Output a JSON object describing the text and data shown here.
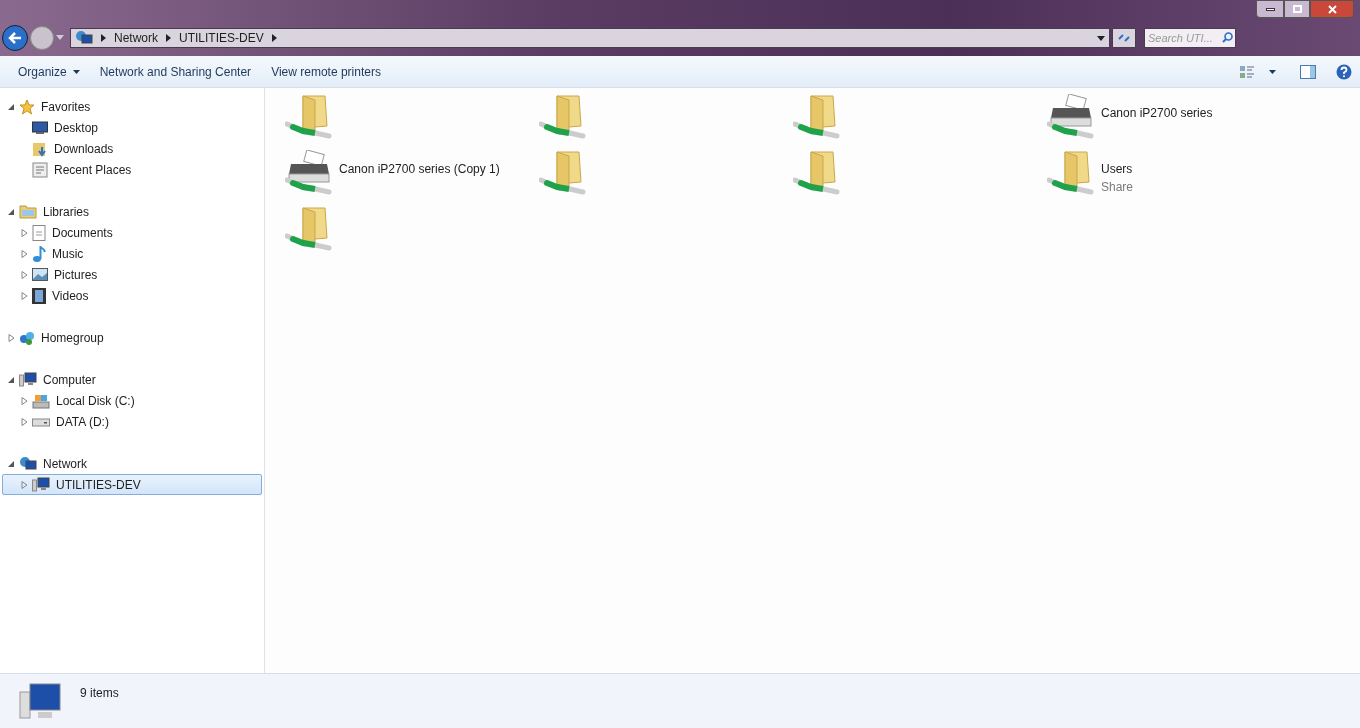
{
  "address_bar": {
    "crumbs": [
      "Network",
      "UTILITIES-DEV"
    ]
  },
  "search": {
    "placeholder": "Search UTI..."
  },
  "toolbar": {
    "buttons": [
      {
        "label": "Organize",
        "dropdown": true
      },
      {
        "label": "Network and Sharing Center",
        "dropdown": false
      },
      {
        "label": "View remote printers",
        "dropdown": false
      }
    ]
  },
  "sidebar": {
    "groups": [
      {
        "label": "Favorites",
        "expanded": true,
        "selected": false,
        "children": [
          {
            "label": "Desktop",
            "expandable": false,
            "selected": false
          },
          {
            "label": "Downloads",
            "expandable": false,
            "selected": false
          },
          {
            "label": "Recent Places",
            "expandable": false,
            "selected": false
          }
        ]
      },
      {
        "label": "Libraries",
        "expanded": true,
        "selected": false,
        "children": [
          {
            "label": "Documents",
            "expandable": true,
            "selected": false
          },
          {
            "label": "Music",
            "expandable": true,
            "selected": false
          },
          {
            "label": "Pictures",
            "expandable": true,
            "selected": false
          },
          {
            "label": "Videos",
            "expandable": true,
            "selected": false
          }
        ]
      },
      {
        "label": "Homegroup",
        "expanded": false,
        "selected": false
      },
      {
        "label": "Computer",
        "expanded": true,
        "selected": false,
        "children": [
          {
            "label": "Local Disk (C:)",
            "expandable": true,
            "selected": false
          },
          {
            "label": "DATA (D:)",
            "expandable": true,
            "selected": false
          }
        ]
      },
      {
        "label": "Network",
        "expanded": true,
        "selected": false,
        "children": [
          {
            "label": "UTILITIES-DEV",
            "expandable": true,
            "selected": true
          }
        ]
      }
    ]
  },
  "items": [
    {
      "kind": "share"
    },
    {
      "kind": "share"
    },
    {
      "kind": "share"
    },
    {
      "kind": "printer",
      "name": "Canon iP2700 series"
    },
    {
      "kind": "printer",
      "name": "Canon iP2700 series (Copy 1)"
    },
    {
      "kind": "share"
    },
    {
      "kind": "share"
    },
    {
      "kind": "share",
      "name": "Users",
      "subtitle": "Share"
    },
    {
      "kind": "share"
    }
  ],
  "status_bar": {
    "text": "9 items"
  }
}
